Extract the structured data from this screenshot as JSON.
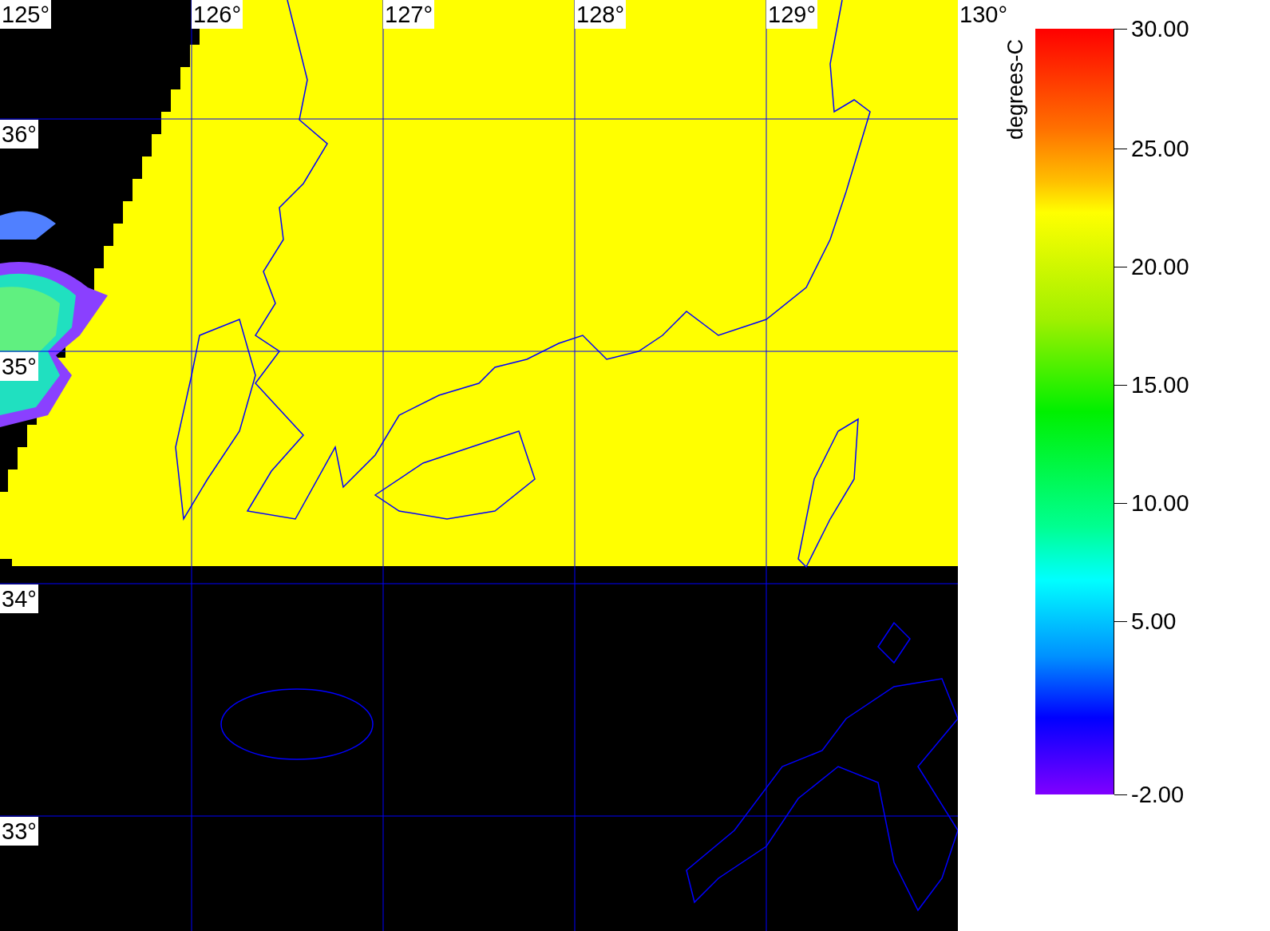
{
  "map": {
    "longitude_labels": [
      "125°",
      "126°",
      "127°",
      "128°",
      "129°",
      "130°"
    ],
    "latitude_labels": [
      "36°",
      "35°",
      "34°",
      "33°"
    ]
  },
  "legend": {
    "unit_label": "degrees-C",
    "ticks": [
      "30.00",
      "25.00",
      "20.00",
      "15.00",
      "10.00",
      "5.00",
      "-2.00"
    ]
  }
}
